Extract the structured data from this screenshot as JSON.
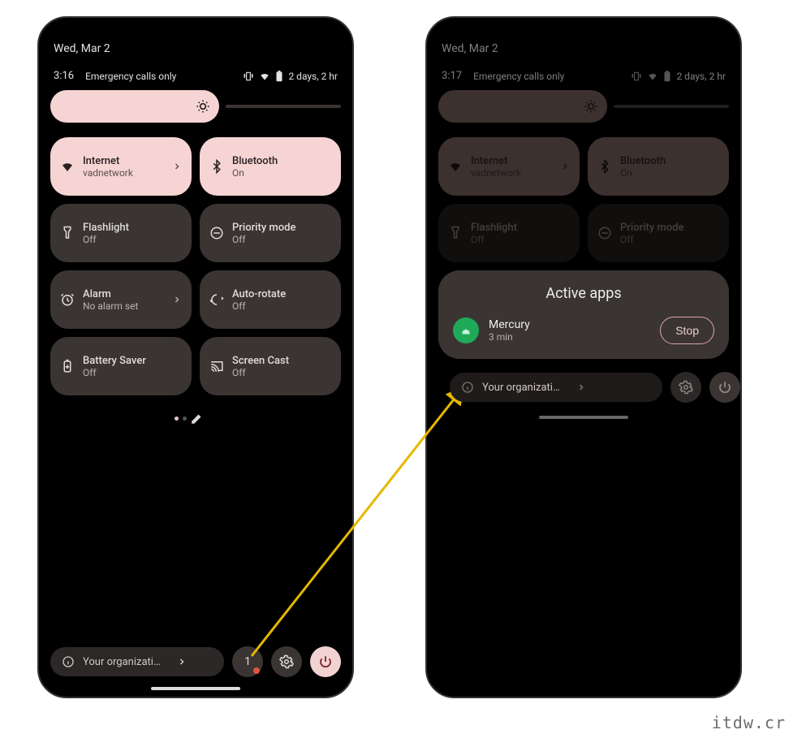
{
  "left": {
    "date": "Wed, Mar 2",
    "time": "3:16",
    "emergency": "Emergency calls only",
    "battery_text": "2 days, 2 hr",
    "tiles": {
      "internet": {
        "title": "Internet",
        "sub": "vadnetwork"
      },
      "bluetooth": {
        "title": "Bluetooth",
        "sub": "On"
      },
      "flashlight": {
        "title": "Flashlight",
        "sub": "Off"
      },
      "priority": {
        "title": "Priority mode",
        "sub": "Off"
      },
      "alarm": {
        "title": "Alarm",
        "sub": "No alarm set"
      },
      "autorotate": {
        "title": "Auto-rotate",
        "sub": "Off"
      },
      "battery": {
        "title": "Battery Saver",
        "sub": "Off"
      },
      "cast": {
        "title": "Screen Cast",
        "sub": "Off"
      }
    },
    "org": "Your organizati…",
    "active_count": "1"
  },
  "right": {
    "date": "Wed, Mar 2",
    "time": "3:17",
    "emergency": "Emergency calls only",
    "battery_text": "2 days, 2 hr",
    "tiles": {
      "internet": {
        "title": "Internet",
        "sub": "vadnetwork"
      },
      "bluetooth": {
        "title": "Bluetooth",
        "sub": "On"
      },
      "flashlight": {
        "title": "Flashlight",
        "sub": "Off"
      },
      "priority": {
        "title": "Priority mode",
        "sub": "Off"
      }
    },
    "active_apps": {
      "heading": "Active apps",
      "app": {
        "name": "Mercury",
        "duration": "3 min"
      },
      "stop": "Stop"
    },
    "org": "Your organizati…"
  },
  "watermark": "itdw.cr"
}
